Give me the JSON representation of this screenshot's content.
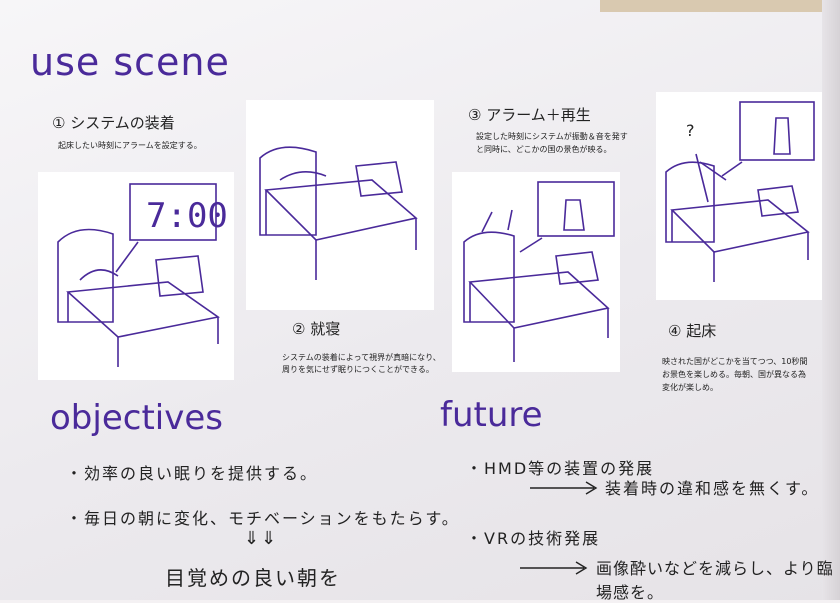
{
  "headings": {
    "use_scene": "use scene",
    "objectives": "objectives",
    "future": "future"
  },
  "scenes": [
    {
      "step": "① システムの装着",
      "note": "起床したい時刻にアラームを設定する。",
      "clock": "7:00"
    },
    {
      "step": "② 就寝",
      "note_line1": "システムの装着によって視界が真暗になり、",
      "note_line2": "周りを気にせず眠りにつくことができる。"
    },
    {
      "step": "③ アラーム＋再生",
      "note_line1": "設定した時刻にシステムが振動＆音を発す",
      "note_line2": "と同時に、どこかの国の景色が映る。"
    },
    {
      "step": "④ 起床",
      "note_line1": "映された国がどこかを当てつつ、10秒間",
      "note_line2": "お景色を楽しめる。毎朝、国が異なる為",
      "note_line3": "変化が楽しめ。"
    }
  ],
  "objectives": {
    "item1": "・効率の良い眠りを提供する。",
    "item2": "・毎日の朝に変化、モチベーションをもたらす。",
    "arrow": "⇓⇓",
    "conclusion": "目覚めの良い朝を"
  },
  "future": {
    "item1": "・HMD等の装置の発展",
    "item1_result": "装着時の違和感を無くす。",
    "item2": "・VRの技術発展",
    "item2_result": "画像酔いなどを減らし、より臨場感を。"
  },
  "colors": {
    "accent": "#4a2a9a",
    "ink": "#222222"
  }
}
